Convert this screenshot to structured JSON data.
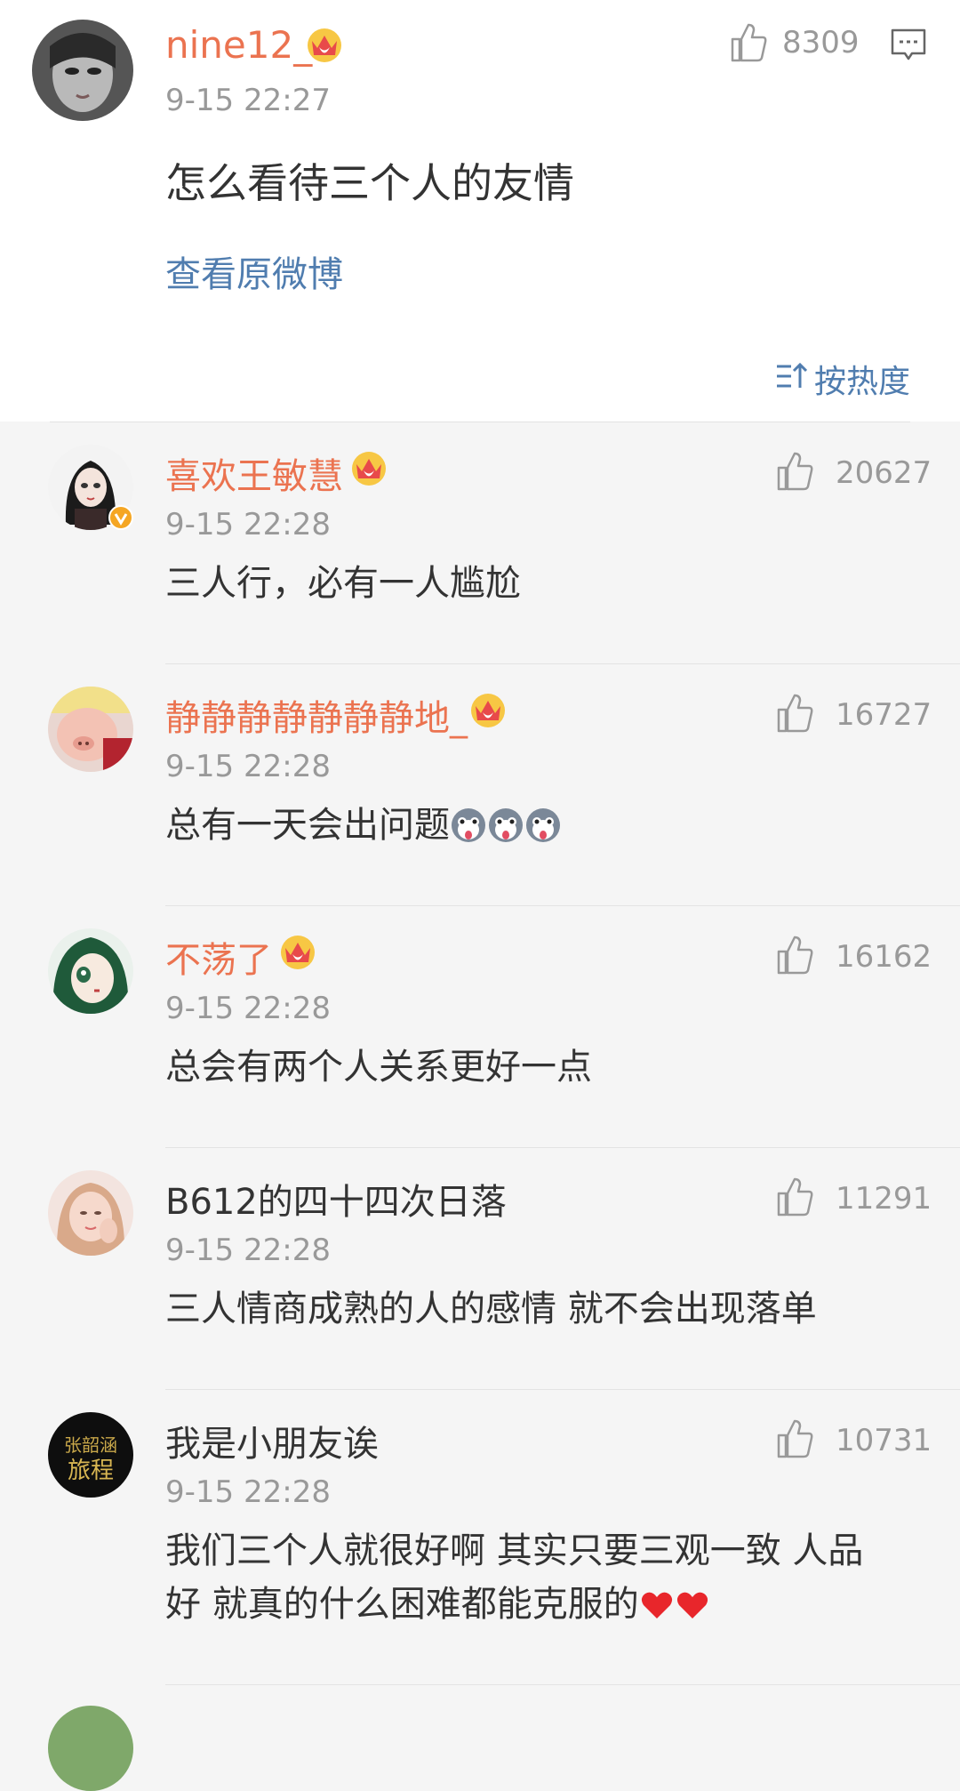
{
  "post": {
    "author": "nine12_",
    "time": "9-15 22:27",
    "text": "怎么看待三个人的友情",
    "view_original": "查看原微博",
    "likes": "8309",
    "sort_label": "按热度"
  },
  "comments": [
    {
      "name": "喜欢王敏慧",
      "time": "9-15 22:28",
      "text": "三人行，必有一人尴尬",
      "likes": "20627",
      "vip": true,
      "verified": true
    },
    {
      "name": "静静静静静静静地_",
      "time": "9-15 22:28",
      "text": "总有一天会出问题",
      "likes": "16727",
      "vip": true,
      "emoji": "husky x3"
    },
    {
      "name": "不荡了",
      "time": "9-15 22:28",
      "text": "总会有两个人关系更好一点",
      "likes": "16162",
      "vip": true
    },
    {
      "name": "B612的四十四次日落",
      "time": "9-15 22:28",
      "text": "三人情商成熟的人的感情 就不会出现落单",
      "likes": "11291",
      "vip": false
    },
    {
      "name": "我是小朋友诶",
      "time": "9-15 22:28",
      "text_line1": "我们三个人就很好啊 其实只要三观一致 人品",
      "text_line2": "好 就真的什么困难都能克服的",
      "likes": "10731",
      "vip": false,
      "avatar_text": "张韶涵 旅程"
    }
  ],
  "colors": {
    "accent_name": "#eb7350",
    "link": "#507daf",
    "muted": "#999999",
    "text": "#333333"
  },
  "icons": [
    "like-icon",
    "comment-icon",
    "crown-icon",
    "sort-icon",
    "verified-badge-icon",
    "heart-icon",
    "husky-emoji-icon"
  ]
}
